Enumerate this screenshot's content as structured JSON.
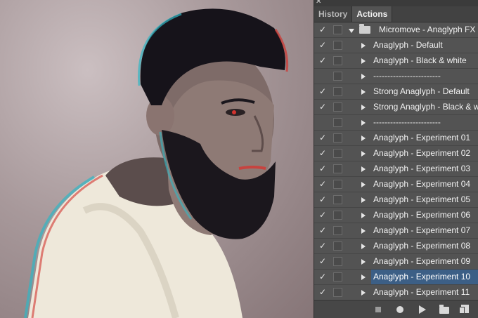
{
  "panel": {
    "close_glyph": "✕",
    "tabs": [
      {
        "label": "History",
        "active": false
      },
      {
        "label": "Actions",
        "active": true
      }
    ],
    "check_glyph": "✓",
    "items": [
      {
        "label": "Micromove - Anaglyph FX",
        "checked": true,
        "kind": "set"
      },
      {
        "label": "Anaglyph - Default",
        "checked": true
      },
      {
        "label": "Anaglyph - Black & white",
        "checked": true
      },
      {
        "label": "------------------------",
        "checked": false
      },
      {
        "label": "Strong Anaglyph - Default",
        "checked": true
      },
      {
        "label": "Strong Anaglyph - Black & white",
        "checked": true
      },
      {
        "label": "------------------------",
        "checked": false
      },
      {
        "label": "Anaglyph - Experiment 01",
        "checked": true
      },
      {
        "label": "Anaglyph - Experiment 02",
        "checked": true
      },
      {
        "label": "Anaglyph - Experiment 03",
        "checked": true
      },
      {
        "label": "Anaglyph - Experiment 04",
        "checked": true
      },
      {
        "label": "Anaglyph - Experiment 05",
        "checked": true
      },
      {
        "label": "Anaglyph - Experiment 06",
        "checked": true
      },
      {
        "label": "Anaglyph - Experiment 07",
        "checked": true
      },
      {
        "label": "Anaglyph - Experiment 08",
        "checked": true
      },
      {
        "label": "Anaglyph - Experiment 09",
        "checked": true
      },
      {
        "label": "Anaglyph - Experiment 10",
        "checked": true,
        "selected": true
      },
      {
        "label": "Anaglyph - Experiment 11",
        "checked": true
      }
    ],
    "bottom_icons": [
      "stop-icon",
      "record-icon",
      "play-icon",
      "folder-icon",
      "new-action-icon"
    ]
  },
  "colors": {
    "panel_bg": "#535353",
    "selection": "#3c5f86",
    "anaglyph_red": "#d2332e",
    "anaglyph_cyan": "#31b7c4"
  }
}
